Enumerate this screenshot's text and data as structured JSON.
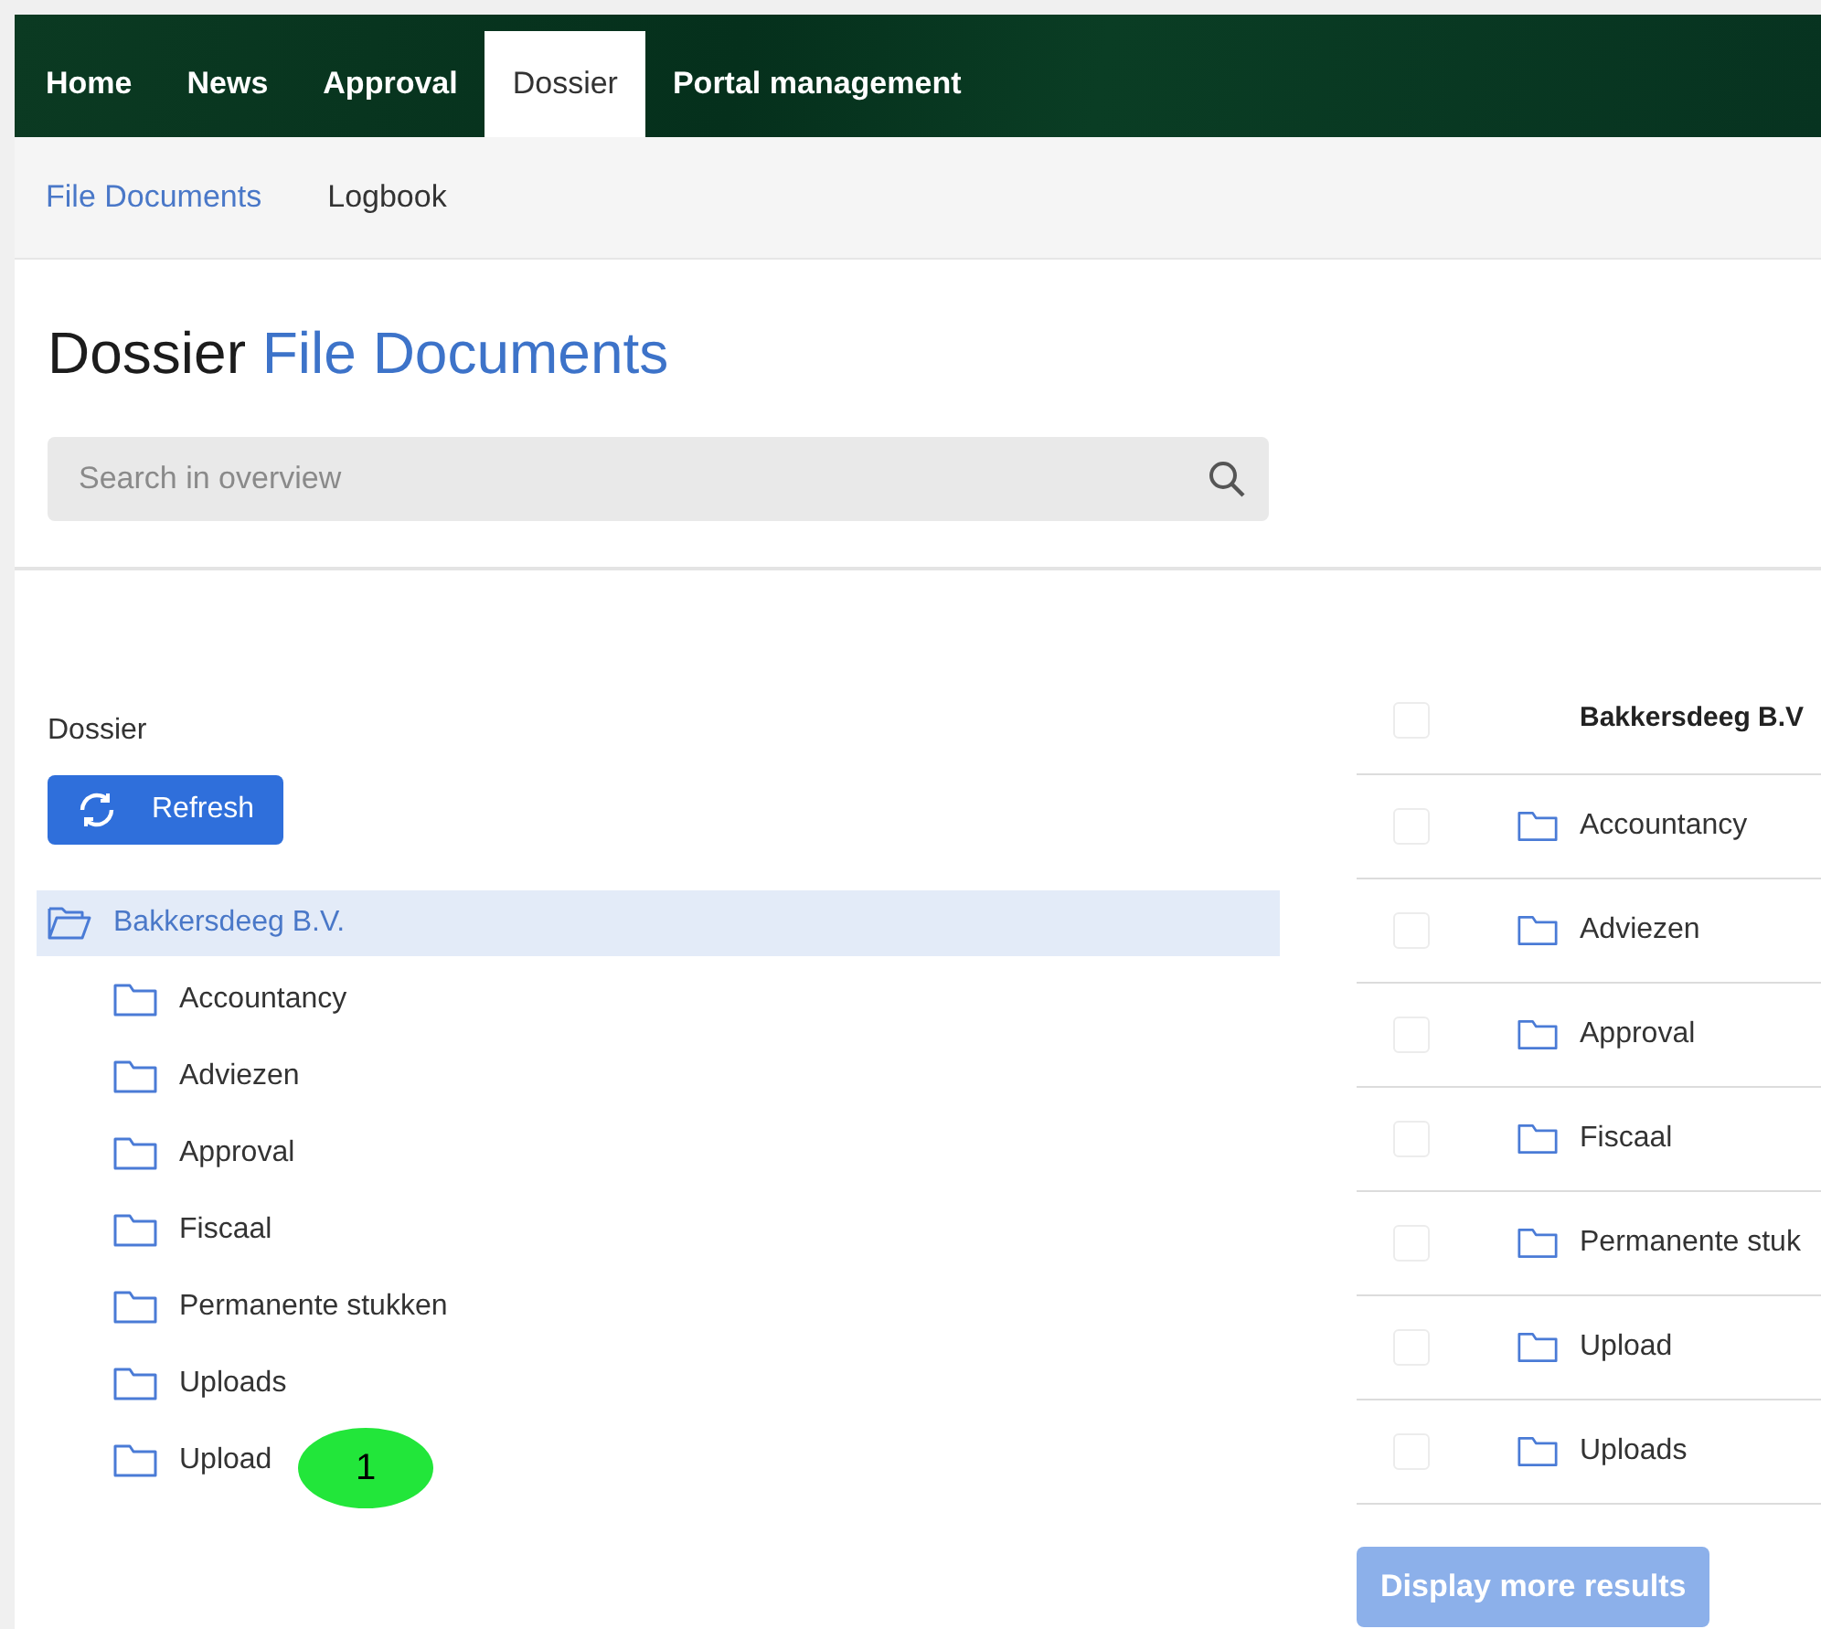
{
  "nav": {
    "tabs": [
      {
        "label": "Home",
        "selected": false
      },
      {
        "label": "News",
        "selected": false
      },
      {
        "label": "Approval",
        "selected": false
      },
      {
        "label": "Dossier",
        "selected": true
      },
      {
        "label": "Portal management",
        "selected": false
      }
    ]
  },
  "subnav": {
    "tabs": [
      {
        "label": "File Documents",
        "selected": true
      },
      {
        "label": "Logbook",
        "selected": false
      }
    ]
  },
  "page_title": {
    "prefix": "Dossier",
    "highlight": "File Documents"
  },
  "search": {
    "placeholder": "Search in overview"
  },
  "tree_panel": {
    "label": "Dossier",
    "refresh_button": "Refresh",
    "tree": [
      {
        "label": "Bakkersdeeg B.V.",
        "selected": true,
        "expanded": true,
        "children": [
          {
            "label": "Accountancy",
            "selected": false
          },
          {
            "label": "Adviezen",
            "selected": false
          },
          {
            "label": "Approval",
            "selected": false
          },
          {
            "label": "Fiscaal",
            "selected": false
          },
          {
            "label": "Permanente stukken",
            "selected": false
          },
          {
            "label": "Uploads",
            "selected": false
          },
          {
            "label": "Upload",
            "selected": false,
            "badge": "1"
          }
        ]
      }
    ]
  },
  "table": {
    "header": {
      "label": "Bakkersdeeg B.V",
      "checked": false
    },
    "rows": [
      {
        "label": "Accountancy",
        "checked": false
      },
      {
        "label": "Adviezen",
        "checked": false
      },
      {
        "label": "Approval",
        "checked": false
      },
      {
        "label": "Fiscaal",
        "checked": false
      },
      {
        "label": "Permanente stuk",
        "checked": false
      },
      {
        "label": "Upload",
        "checked": false
      },
      {
        "label": "Uploads",
        "checked": false
      }
    ],
    "more_button": "Display more results"
  }
}
